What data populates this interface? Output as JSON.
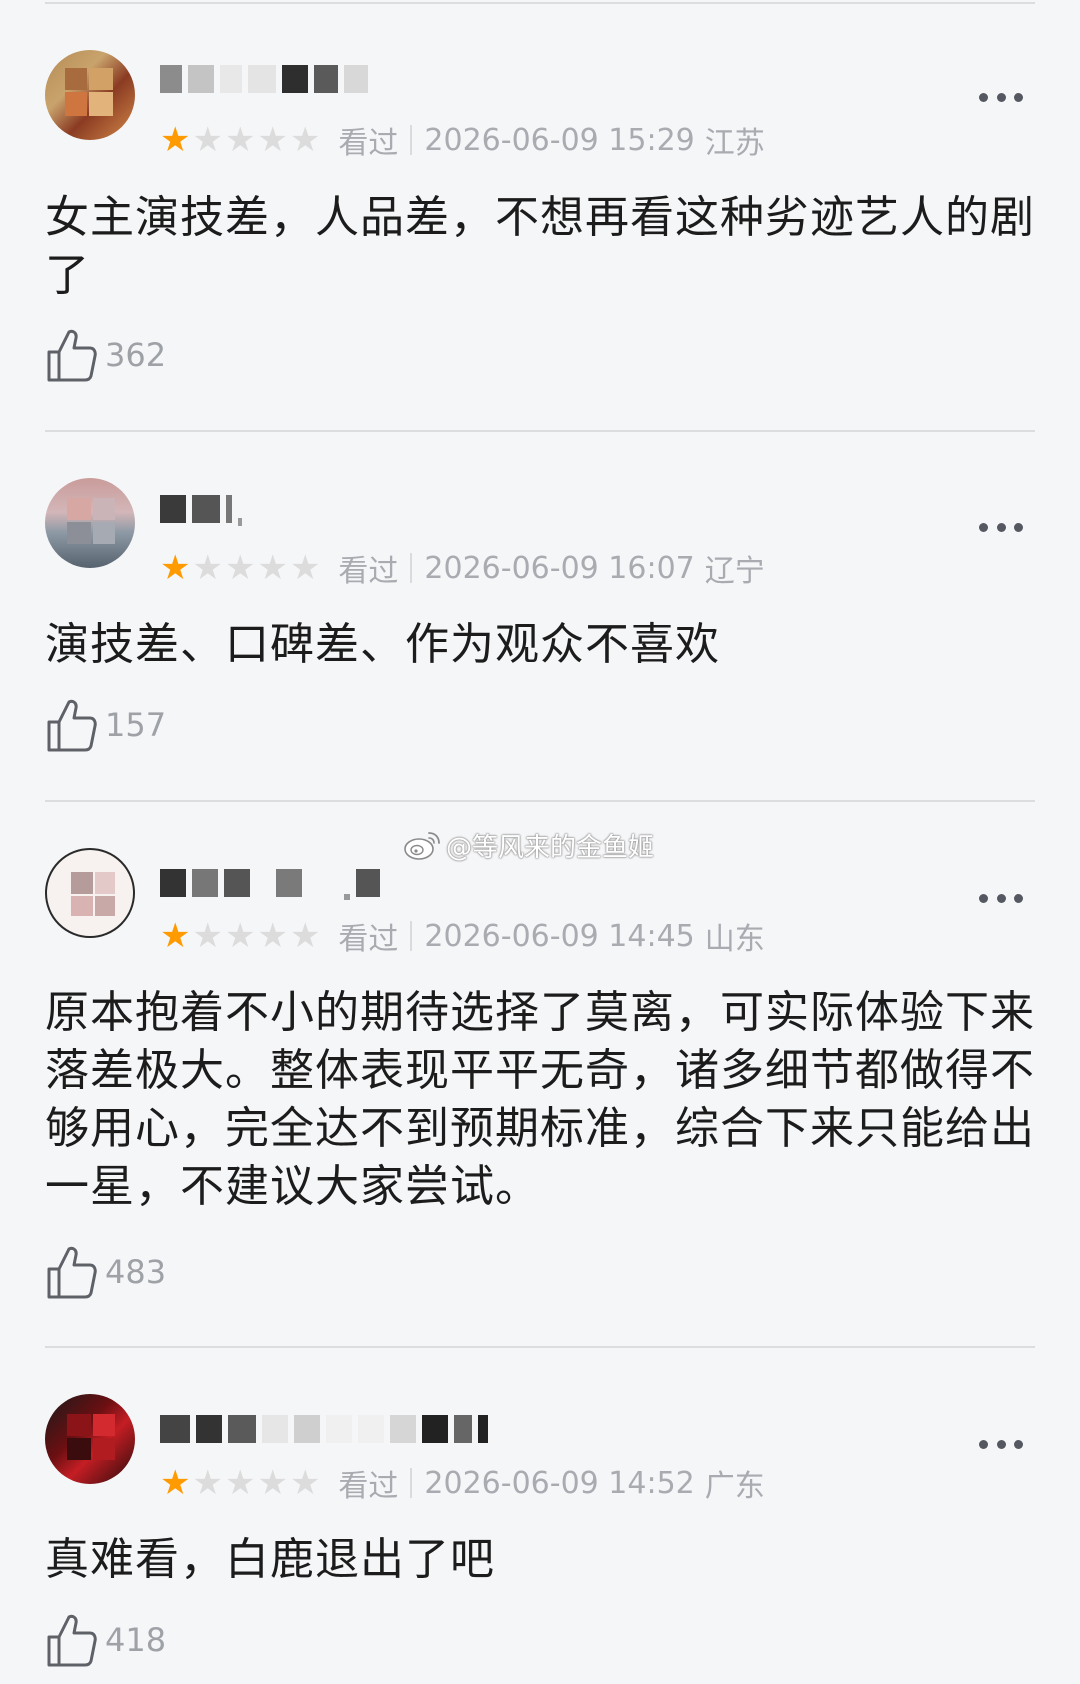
{
  "watermark": {
    "text": "@等风来的金鱼姬"
  },
  "colors": {
    "star_active": "#ff9a00",
    "star_inactive": "#dcdcdc",
    "meta_text": "#a9abb0",
    "background": "#f5f6f8"
  },
  "icons": {
    "like": "thumbs-up-icon",
    "more": "more-dots-icon",
    "star": "star-icon",
    "watermark": "weibo-logo-icon"
  },
  "reviews": [
    {
      "rating": 1,
      "max_rating": 5,
      "status": "看过",
      "datetime": "2026-06-09 15:29",
      "location": "江苏",
      "text": "女主演技差，人品差，不想再看这种劣迹艺人的剧了",
      "likes": "362"
    },
    {
      "rating": 1,
      "max_rating": 5,
      "status": "看过",
      "datetime": "2026-06-09 16:07",
      "location": "辽宁",
      "text": "演技差、口碑差、作为观众不喜欢",
      "likes": "157"
    },
    {
      "rating": 1,
      "max_rating": 5,
      "status": "看过",
      "datetime": "2026-06-09 14:45",
      "location": "山东",
      "text": "原本抱着不小的期待选择了莫离，可实际体验下来落差极大。整体表现平平无奇，诸多细节都做得不够用心，完全达不到预期标准，综合下来只能给出一星，不建议大家尝试。",
      "likes": "483"
    },
    {
      "rating": 1,
      "max_rating": 5,
      "status": "看过",
      "datetime": "2026-06-09 14:52",
      "location": "广东",
      "text": "真难看，白鹿退出了吧",
      "likes": "418"
    }
  ]
}
